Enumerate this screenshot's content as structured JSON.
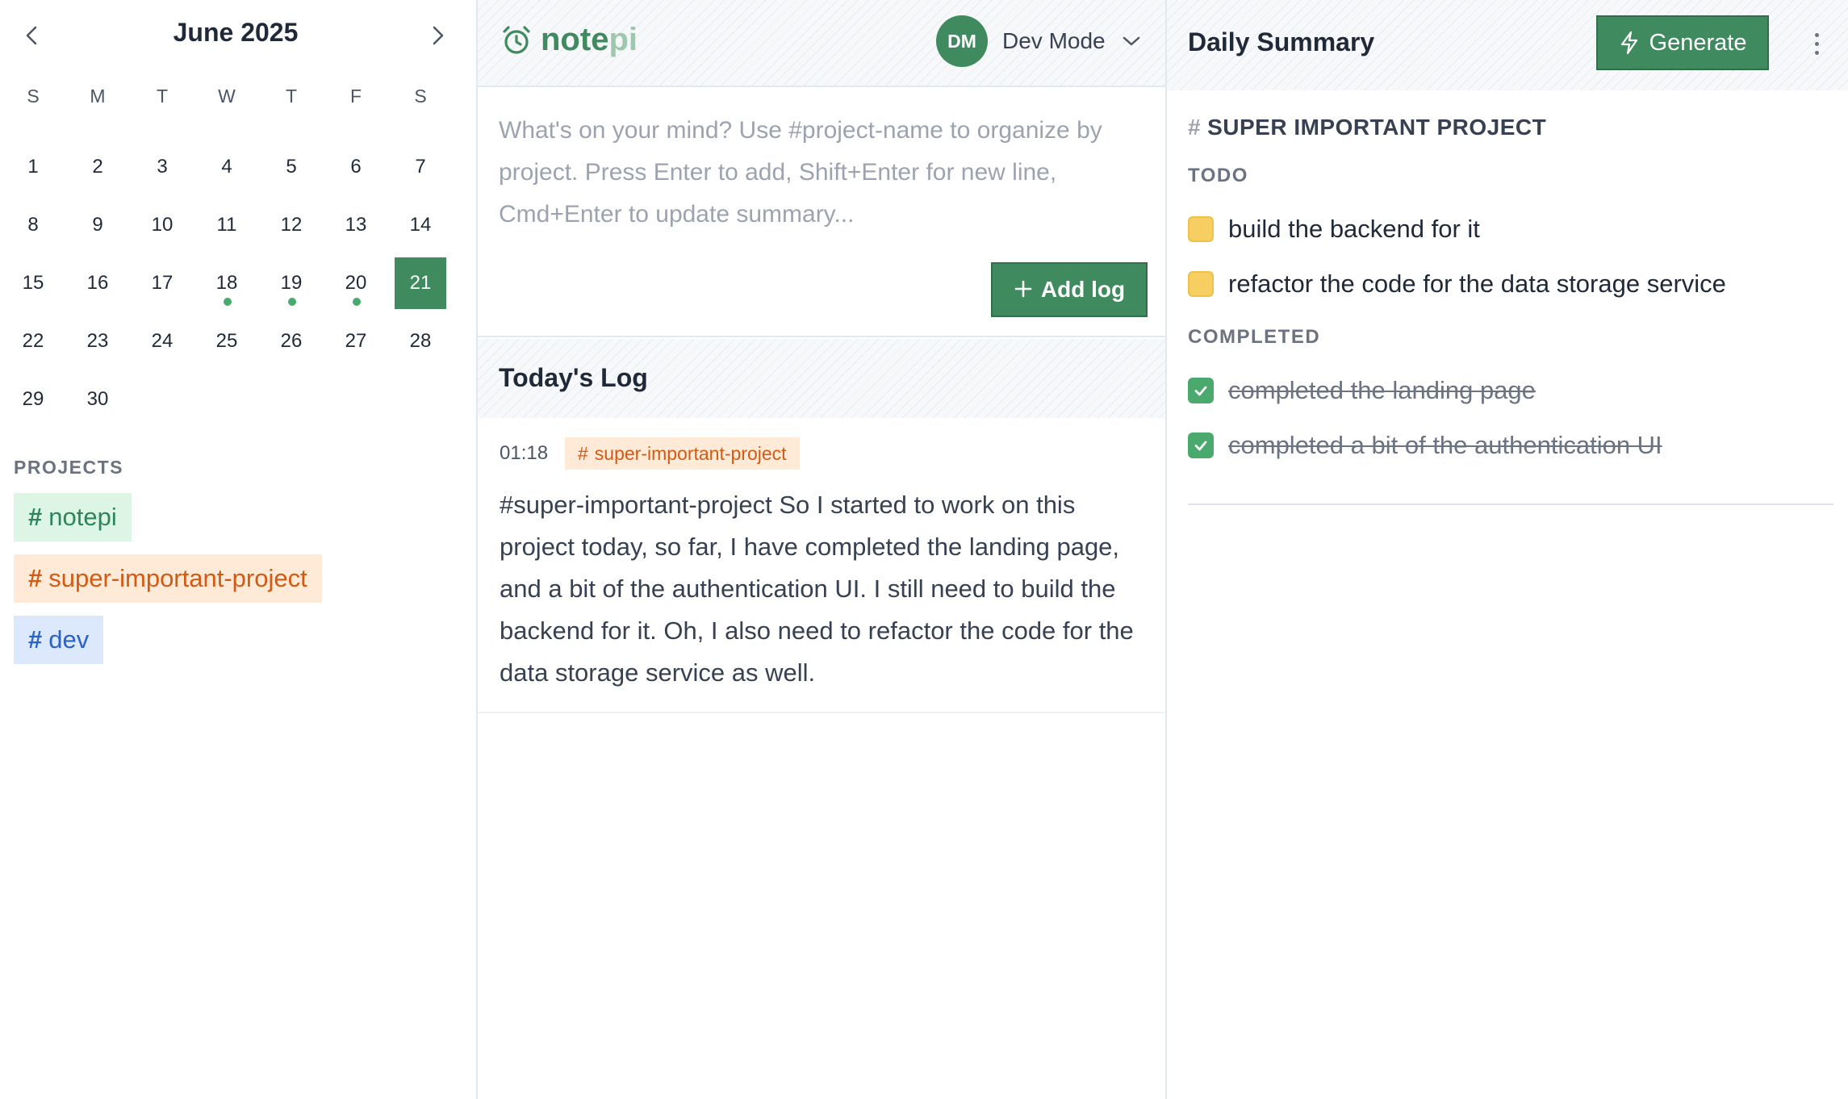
{
  "calendar": {
    "month_title": "June 2025",
    "weekdays": [
      "S",
      "M",
      "T",
      "W",
      "T",
      "F",
      "S"
    ],
    "days": [
      "1",
      "2",
      "3",
      "4",
      "5",
      "6",
      "7",
      "8",
      "9",
      "10",
      "11",
      "12",
      "13",
      "14",
      "15",
      "16",
      "17",
      "18",
      "19",
      "20",
      "21",
      "22",
      "23",
      "24",
      "25",
      "26",
      "27",
      "28",
      "29",
      "30"
    ],
    "selected_day": "21",
    "days_with_logs": [
      "18",
      "19",
      "20"
    ]
  },
  "projects": {
    "heading": "PROJECTS",
    "hash": "#",
    "items": [
      {
        "label": "notepi",
        "color": "#2f855a"
      },
      {
        "label": "super-important-project",
        "color": "#d35a14"
      },
      {
        "label": "dev",
        "color": "#2b62c9"
      }
    ]
  },
  "header": {
    "logo_main": "note",
    "logo_accent": "pi",
    "logo_icon": "alarm-clock-icon",
    "avatar_initials": "DM",
    "user_name": "Dev Mode"
  },
  "composer": {
    "placeholder": "What's on your mind? Use #project-name to organize by project. Press Enter to add, Shift+Enter for new line, Cmd+Enter to update summary...",
    "value": "",
    "add_button_label": "Add log"
  },
  "log": {
    "title": "Today's Log",
    "entries": [
      {
        "time": "01:18",
        "tag": "super-important-project",
        "text": "#super-important-project So I started to work on this project today, so far, I have completed the landing page, and a bit of the authentication UI. I still need to build the backend for it. Oh, I also need to refactor the code for the data storage service as well."
      }
    ]
  },
  "summary": {
    "title": "Daily Summary",
    "generate_label": "Generate",
    "project_hash": "#",
    "project_title": "SUPER IMPORTANT PROJECT",
    "todo_heading": "TODO",
    "todo_items": [
      "build the backend for it",
      "refactor the code for the data storage service"
    ],
    "completed_heading": "COMPLETED",
    "completed_items": [
      "completed the landing page",
      "completed a bit of the authentication UI"
    ]
  },
  "colors": {
    "accent": "#3f8a5e",
    "todo_box": "#f7ce62",
    "done_box": "#4aa96c"
  }
}
